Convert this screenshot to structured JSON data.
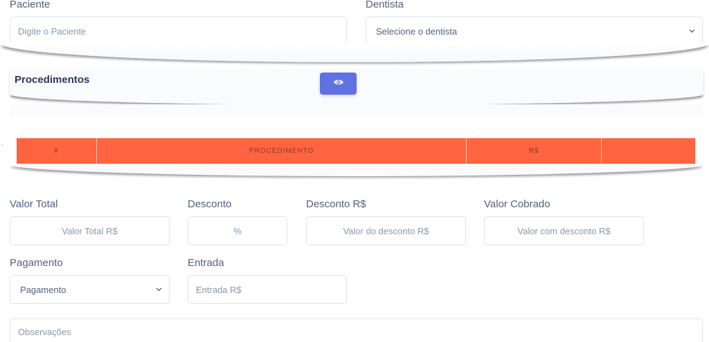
{
  "patient": {
    "label": "Paciente",
    "placeholder": "Digite o Paciente"
  },
  "dentist": {
    "label": "Dentista",
    "selected": "Selecione o dentista"
  },
  "procedures": {
    "title": "Procedimentos",
    "view_icon": "eye-icon",
    "table_headers": [
      "#",
      "PROCEDIMENTO",
      "R$",
      ""
    ]
  },
  "totals": {
    "valor_total": {
      "label": "Valor Total",
      "placeholder": "Valor Total R$"
    },
    "desconto": {
      "label": "Desconto",
      "placeholder": "%"
    },
    "desconto_rs": {
      "label": "Desconto R$",
      "placeholder": "Valor do desconto R$"
    },
    "valor_cobrado": {
      "label": "Valor Cobrado",
      "placeholder": "Valor com desconto R$"
    }
  },
  "payment": {
    "pagamento": {
      "label": "Pagamento",
      "selected": "Pagamento"
    },
    "entrada": {
      "label": "Entrada",
      "placeholder": "Entrada R$"
    }
  },
  "notes": {
    "placeholder": "Observações"
  },
  "colors": {
    "accent": "#5e72e4",
    "table_header": "#fe643f"
  }
}
